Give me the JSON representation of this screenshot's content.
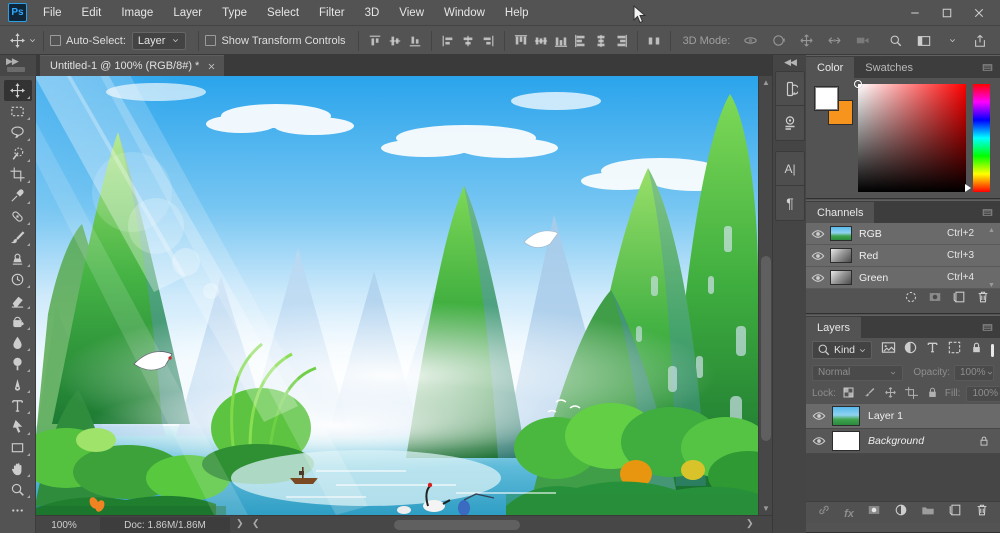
{
  "app": {
    "logo": "Ps"
  },
  "window": {
    "controls": [
      "window-minimize-icon",
      "window-maximize-icon",
      "window-close-icon"
    ]
  },
  "menu": {
    "items": [
      "File",
      "Edit",
      "Image",
      "Layer",
      "Type",
      "Select",
      "Filter",
      "3D",
      "View",
      "Window",
      "Help"
    ]
  },
  "options_bar": {
    "tool_icon": "move-tool",
    "auto_select_label": "Auto-Select:",
    "auto_select_value": "Layer",
    "show_transform_label": "Show Transform Controls",
    "align_groups": [
      [
        "align-top-edges",
        "align-vertical-centers",
        "align-bottom-edges"
      ],
      [
        "align-left-edges",
        "align-horizontal-centers",
        "align-right-edges"
      ],
      [
        "distribute-top-edges",
        "distribute-vertical-centers",
        "distribute-bottom-edges",
        "distribute-left-edges",
        "distribute-horizontal-centers",
        "distribute-right-edges"
      ],
      [
        "distribute-spacing"
      ]
    ],
    "mode_label": "3D Mode:",
    "three_d_icons": [
      "orbit-3d-icon",
      "roll-3d-icon",
      "drag-3d-icon",
      "slide-3d-icon",
      "dolly-3d-icon"
    ],
    "right_icons": [
      "search-icon",
      "workspace-switcher-icon",
      "chevron-down-icon",
      "share-icon"
    ]
  },
  "document_tab": {
    "title": "Untitled-1 @ 100% (RGB/8#) *"
  },
  "toolbar": {
    "tools": [
      {
        "name": "move-tool",
        "selected": true
      },
      {
        "name": "marquee-tool"
      },
      {
        "name": "lasso-tool"
      },
      {
        "name": "quick-select-tool"
      },
      {
        "name": "crop-tool"
      },
      {
        "name": "eyedropper-tool"
      },
      {
        "name": "healing-brush-tool"
      },
      {
        "name": "brush-tool"
      },
      {
        "name": "clone-stamp-tool"
      },
      {
        "name": "history-brush-tool"
      },
      {
        "name": "eraser-tool"
      },
      {
        "name": "gradient-tool"
      },
      {
        "name": "blur-tool"
      },
      {
        "name": "dodge-tool"
      },
      {
        "name": "pen-tool"
      },
      {
        "name": "type-tool"
      },
      {
        "name": "path-select-tool"
      },
      {
        "name": "rectangle-tool"
      },
      {
        "name": "hand-tool"
      },
      {
        "name": "zoom-tool"
      },
      {
        "name": "toolbar-ellipsis"
      }
    ]
  },
  "canvas": {
    "description": "Oil painting of Guilin karst landscape: sun rays over blue sky, green limestone peaks, hazy blue distant mountains, river with boat, cranes and lush trees"
  },
  "status_bar": {
    "zoom_value": "100%",
    "doc_label": "Doc: 1.86M/1.86M"
  },
  "dock_strip": {
    "groups": [
      [
        "history-panel-icon",
        "adjustments-panel-icon"
      ],
      [
        "character-panel-icon",
        "paragraph-panel-icon"
      ]
    ],
    "character_glyph": "A|",
    "paragraph_glyph": "¶"
  },
  "panels": {
    "color": {
      "tab_color": "Color",
      "tab_swatches": "Swatches",
      "foreground_color": "#ffffff",
      "background_color": "#f7941d"
    },
    "channels": {
      "title": "Channels",
      "rows": [
        {
          "label": "RGB",
          "shortcut": "Ctrl+2",
          "thumb": "color"
        },
        {
          "label": "Red",
          "shortcut": "Ctrl+3",
          "thumb": "gray"
        },
        {
          "label": "Green",
          "shortcut": "Ctrl+4",
          "thumb": "gray"
        }
      ],
      "action_icons": [
        "load-selection-icon",
        "save-selection-icon",
        "new-channel-icon",
        "delete-channel-icon"
      ]
    },
    "layers": {
      "title": "Layers",
      "kind_label": "Kind",
      "filter_icons": [
        "pixel-layer-filter-icon",
        "adjustment-layer-filter-icon",
        "type-layer-filter-icon",
        "shape-layer-filter-icon",
        "smart-object-filter-icon"
      ],
      "blend_mode": "Normal",
      "opacity_label": "Opacity:",
      "opacity_value": "100%",
      "lock_label": "Lock:",
      "lock_icons": [
        "lock-transparency-icon",
        "lock-paint-icon",
        "lock-position-icon",
        "lock-artboard-icon",
        "lock-all-icon"
      ],
      "fill_label": "Fill:",
      "fill_value": "100%",
      "rows": [
        {
          "label": "Layer 1",
          "thumb": "color",
          "selected": true
        },
        {
          "label": "Background",
          "thumb": "white",
          "italic": true,
          "locked": true
        }
      ],
      "action_icons": [
        "link-layers-icon",
        "layer-style-icon",
        "layer-mask-icon",
        "adjustment-layer-icon",
        "layer-group-icon",
        "new-layer-icon",
        "delete-layer-icon"
      ]
    }
  }
}
